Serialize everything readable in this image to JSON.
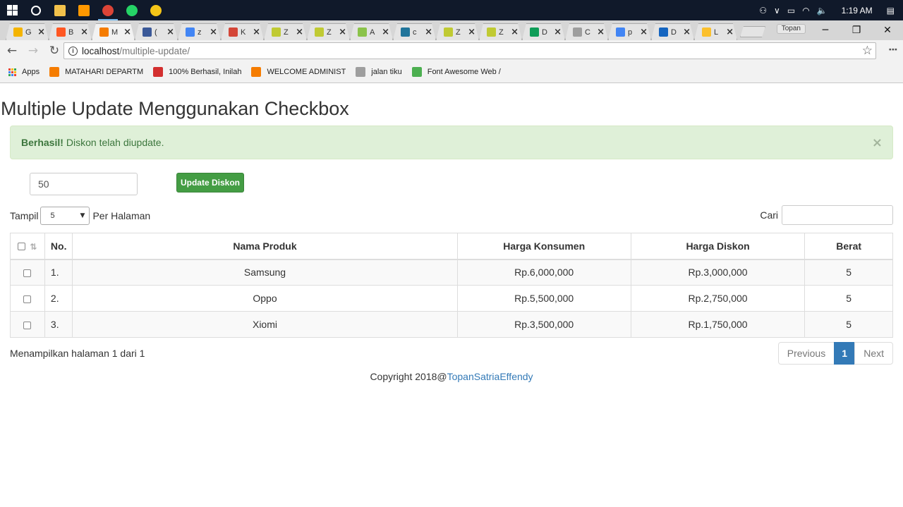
{
  "taskbar": {
    "apps": [
      {
        "name": "file-explorer-icon",
        "color": "#f2c14b"
      },
      {
        "name": "sublime-icon",
        "color": "#ff9800"
      },
      {
        "name": "chrome-icon",
        "color": "#db4437"
      },
      {
        "name": "whatsapp-icon",
        "color": "#25d366"
      },
      {
        "name": "bird-app-icon",
        "color": "#f5c518"
      }
    ],
    "time": "1:19 AM"
  },
  "browser": {
    "tabs": [
      {
        "title": "G",
        "color": "#f4b400"
      },
      {
        "title": "B",
        "color": "#ff5722"
      },
      {
        "title": "M",
        "color": "#f57c00",
        "active": true
      },
      {
        "title": "(",
        "color": "#3b5998"
      },
      {
        "title": "z",
        "color": "#4285f4"
      },
      {
        "title": "K",
        "color": "#d44638"
      },
      {
        "title": "Z",
        "color": "#c0ca33"
      },
      {
        "title": "Z",
        "color": "#c0ca33"
      },
      {
        "title": "A",
        "color": "#8bc34a"
      },
      {
        "title": "c",
        "color": "#21759b"
      },
      {
        "title": "Z",
        "color": "#c0ca33"
      },
      {
        "title": "Z",
        "color": "#c0ca33"
      },
      {
        "title": "D",
        "color": "#0f9d58"
      },
      {
        "title": "C",
        "color": "#9e9e9e"
      },
      {
        "title": "p",
        "color": "#4285f4"
      },
      {
        "title": "D",
        "color": "#1565c0"
      },
      {
        "title": "L",
        "color": "#fbc02d"
      }
    ],
    "profile": "Topan",
    "url_host": "localhost",
    "url_path": "/multiple-update/",
    "bookmarks": [
      {
        "label": "Apps",
        "kind": "apps"
      },
      {
        "label": "MATAHARI DEPARTM",
        "color": "#f57c00"
      },
      {
        "label": "100% Berhasil, Inilah",
        "color": "#d32f2f"
      },
      {
        "label": "WELCOME ADMINIST",
        "color": "#f57c00"
      },
      {
        "label": "jalan tiku",
        "color": "#9e9e9e"
      },
      {
        "label": "Font Awesome Web /",
        "color": "#4caf50"
      }
    ]
  },
  "page": {
    "title": "Multiple Update Menggunakan Checkbox",
    "alert_strong": "Berhasil!",
    "alert_text": "Diskon telah diupdate.",
    "alert_close": "×",
    "discount_value": "50",
    "update_button": "Update Diskon",
    "show_label": "Tampil",
    "per_page_value": "5",
    "per_page_label": "Per Halaman",
    "search_label": "Cari",
    "columns": [
      "No.",
      "Nama Produk",
      "Harga Konsumen",
      "Harga Diskon",
      "Berat"
    ],
    "rows": [
      {
        "no": "1.",
        "name": "Samsung",
        "price": "Rp.6,000,000",
        "discount": "Rp.3,000,000",
        "weight": "5"
      },
      {
        "no": "2.",
        "name": "Oppo",
        "price": "Rp.5,500,000",
        "discount": "Rp.2,750,000",
        "weight": "5"
      },
      {
        "no": "3.",
        "name": "Xiomi",
        "price": "Rp.3,500,000",
        "discount": "Rp.1,750,000",
        "weight": "5"
      }
    ],
    "info": "Menampilkan halaman 1 dari 1",
    "pager": {
      "prev": "Previous",
      "current": "1",
      "next": "Next"
    },
    "footer_text": "Copyright 2018@",
    "footer_link": "TopanSatriaEffendy"
  }
}
